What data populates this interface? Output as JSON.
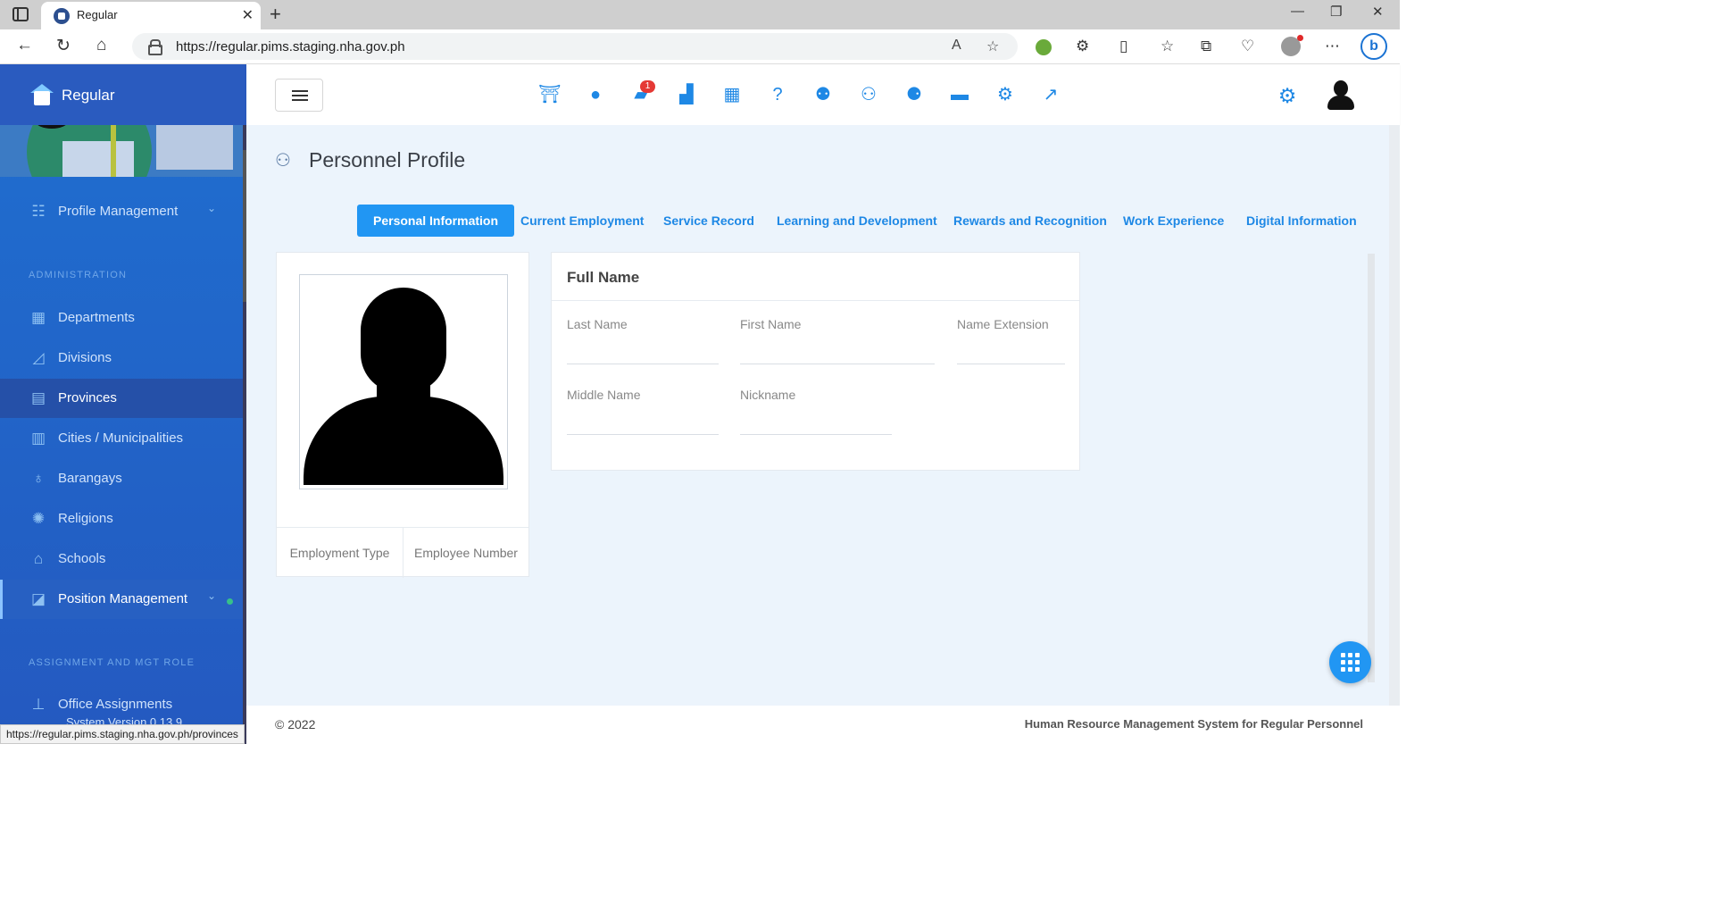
{
  "browser": {
    "tab_title": "Regular",
    "tab_close": "✕",
    "new_tab": "+",
    "url": "https://regular.pims.staging.nha.gov.ph",
    "window_controls": [
      "—",
      "❐",
      "✕"
    ],
    "nav_icons": [
      "back-icon",
      "refresh-icon",
      "home-icon"
    ],
    "status_url": "https://regular.pims.staging.nha.gov.ph/provinces"
  },
  "sidebar": {
    "brand": "Regular",
    "items_top": [
      {
        "label": "Profile Management",
        "icon": "users-icon",
        "chevron": "⌄"
      }
    ],
    "section_admin": "ADMINISTRATION",
    "admin_items": [
      {
        "label": "Departments",
        "icon": "building-icon"
      },
      {
        "label": "Divisions",
        "icon": "chart-area-icon"
      },
      {
        "label": "Provinces",
        "icon": "map-icon"
      },
      {
        "label": "Cities / Municipalities",
        "icon": "city-icon"
      },
      {
        "label": "Barangays",
        "icon": "map-pin-icon"
      },
      {
        "label": "Religions",
        "icon": "atom-icon"
      },
      {
        "label": "Schools",
        "icon": "school-icon"
      },
      {
        "label": "Position Management",
        "icon": "chart-line-icon",
        "chevron": "⌄"
      }
    ],
    "section_assignment": "ASSIGNMENT AND MGT ROLE",
    "assignment_items": [
      {
        "label": "Office Assignments",
        "icon": "pin-icon"
      }
    ],
    "system_version": "System Version 0.13.9"
  },
  "topbar": {
    "badge_count": "1",
    "icons": [
      "gateway-icon",
      "user-icon",
      "briefcase-icon",
      "door-icon",
      "calendar-icon",
      "help-icon",
      "group-icon",
      "group-alt-icon",
      "people-icon",
      "wallet-icon",
      "cog-icon",
      "trend-icon"
    ]
  },
  "page": {
    "title": "Personnel Profile",
    "tabs": [
      "Personal Information",
      "Current Employment",
      "Service Record",
      "Learning and Development",
      "Rewards and Recognition",
      "Work Experience",
      "Digital Information"
    ],
    "photo_card": {
      "employment_type_label": "Employment Type",
      "employee_number_label": "Employee Number"
    },
    "full_name_card": {
      "title": "Full Name",
      "last_name_label": "Last Name",
      "first_name_label": "First Name",
      "name_extension_label": "Name Extension",
      "middle_name_label": "Middle Name",
      "nickname_label": "Nickname",
      "last_name_value": "",
      "first_name_value": "",
      "name_extension_value": "",
      "middle_name_value": "",
      "nickname_value": ""
    }
  },
  "footer": {
    "copyright": "© 2022",
    "system_name": "Human Resource Management System for Regular Personnel"
  },
  "colors": {
    "accent": "#2196f3",
    "sidebar_bg": "#2459c0",
    "badge": "#e53935",
    "content_bg": "#ecf4fc"
  }
}
